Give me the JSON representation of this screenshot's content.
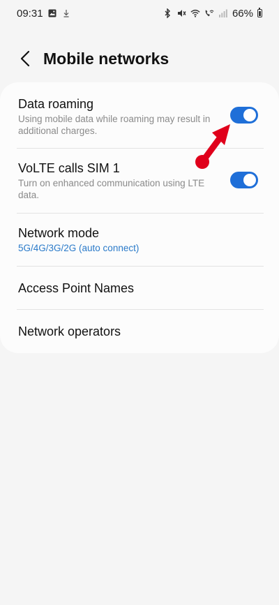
{
  "status_bar": {
    "time": "09:31",
    "battery": "66%",
    "icons": [
      "gallery-icon",
      "download-icon",
      "bluetooth-icon",
      "mute-icon",
      "wifi-icon",
      "wifi-calling-icon",
      "signal-icon",
      "battery-icon"
    ]
  },
  "header": {
    "title": "Mobile networks",
    "back_icon": "back-arrow-icon"
  },
  "settings": {
    "data_roaming": {
      "title": "Data roaming",
      "subtitle": "Using mobile data while roaming may result in additional charges.",
      "enabled": true
    },
    "volte": {
      "title": "VoLTE calls SIM 1",
      "subtitle": "Turn on enhanced communication using LTE data.",
      "enabled": true
    },
    "network_mode": {
      "title": "Network mode",
      "value": "5G/4G/3G/2G (auto connect)"
    },
    "apn": {
      "title": "Access Point Names"
    },
    "operators": {
      "title": "Network operators"
    }
  },
  "colors": {
    "background": "#f5f5f5",
    "card": "#fcfcfc",
    "toggle_on": "#1f6fd8",
    "accent_text": "#2a7ac9",
    "annotation": "#e0001b"
  }
}
